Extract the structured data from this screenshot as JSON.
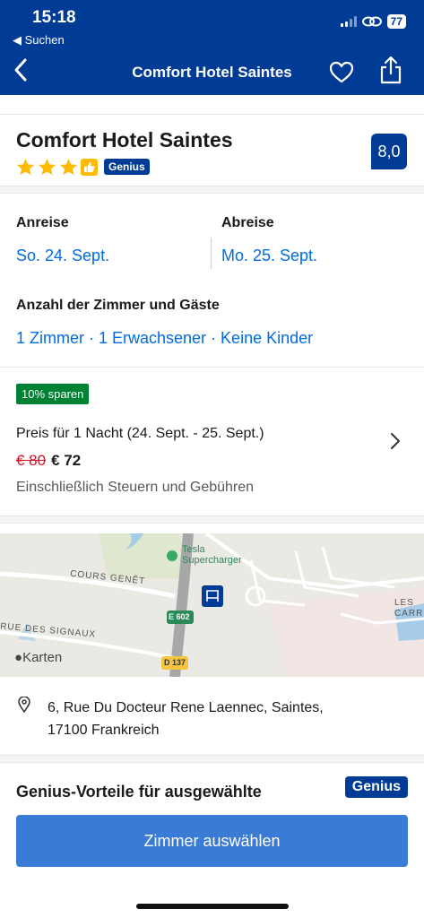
{
  "status_bar": {
    "time": "15:18",
    "back_app": "◀ Suchen",
    "battery": "77"
  },
  "nav": {
    "title": "Comfort Hotel Saintes",
    "icons": [
      "chevron-left-icon",
      "heart-icon",
      "share-icon"
    ]
  },
  "hotel": {
    "name": "Comfort Hotel Saintes",
    "stars": 3,
    "genius_label": "Genius",
    "score": "8,0"
  },
  "dates": {
    "checkin_label": "Anreise",
    "checkin_value": "So. 24. Sept.",
    "checkout_label": "Abreise",
    "checkout_value": "Mo. 25. Sept."
  },
  "guests": {
    "label": "Anzahl der Zimmer und Gäste",
    "value": "1 Zimmer · 1 Erwachsener · Keine Kinder"
  },
  "price": {
    "badge": "10% sparen",
    "label": "Preis für 1 Nacht (24. Sept. - 25. Sept.)",
    "old": "€ 80",
    "new": "€ 72",
    "note": "Einschließlich Steuern und Gebühren"
  },
  "map": {
    "attribution": "Karten",
    "poi": "Tesla\nSupercharger",
    "street_1": "COURS GENÊT",
    "street_2": "RUE DES SIGNAUX",
    "road_1": "E 602",
    "road_2": "D 137",
    "place": "LES\nCARRIE"
  },
  "address": {
    "line1": "6, Rue Du Docteur Rene Laennec, Saintes,",
    "line2": "17100 Frankreich"
  },
  "genius_section": {
    "title": "Genius-Vorteile für ausgewählte",
    "logo": "Genius"
  },
  "cta": {
    "label": "Zimmer auswählen"
  },
  "colors": {
    "brand_blue": "#003b95",
    "link_blue": "#006ce4",
    "cta_blue": "#3a7bd5",
    "save_green": "#008234",
    "old_price_red": "#d4111e",
    "star_yellow": "#febb02"
  }
}
